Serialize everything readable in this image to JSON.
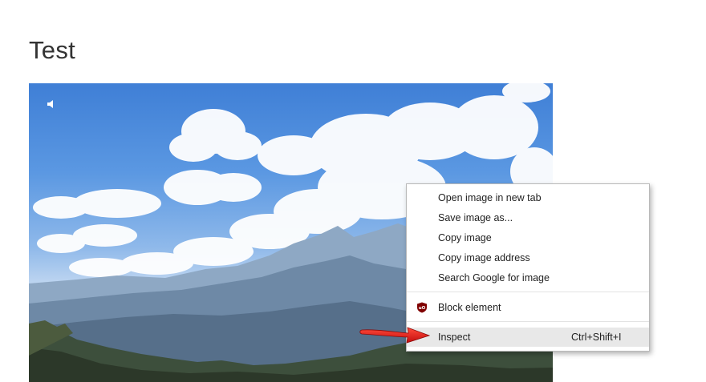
{
  "page": {
    "title": "Test"
  },
  "image": {
    "alt_icon": "speaker-icon"
  },
  "context_menu": {
    "items": [
      {
        "label": "Open image in new tab"
      },
      {
        "label": "Save image as..."
      },
      {
        "label": "Copy image"
      },
      {
        "label": "Copy image address"
      },
      {
        "label": "Search Google for image"
      },
      {
        "label": "Block element",
        "icon": "ublock-origin-icon",
        "icon_color": "#800000"
      },
      {
        "label": "Inspect",
        "shortcut": "Ctrl+Shift+I",
        "highlighted": true
      }
    ]
  },
  "annotation": {
    "arrow_color": "#e02020",
    "points_to": "Inspect"
  }
}
